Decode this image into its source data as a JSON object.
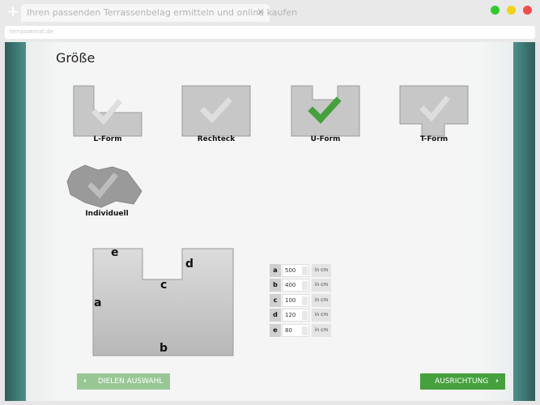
{
  "browser": {
    "tab_title": "Ihren passenden Terrassenbelag ermitteln und online kaufen",
    "url": "terrassenrat.de",
    "new_tab": "+",
    "close": "✕",
    "dot_colors": [
      "#31c930",
      "#f3d21a",
      "#ef4c4c"
    ]
  },
  "page": {
    "title": "Größe"
  },
  "shapes": [
    {
      "label": "L-Form",
      "selected": false
    },
    {
      "label": "Rechteck",
      "selected": false
    },
    {
      "label": "U-Form",
      "selected": true
    },
    {
      "label": "T-Form",
      "selected": false
    },
    {
      "label": "Individuell",
      "selected": false
    }
  ],
  "diagram": {
    "labels": {
      "a": "a",
      "b": "b",
      "c": "c",
      "d": "d",
      "e": "e"
    }
  },
  "dimensions": [
    {
      "key": "a",
      "value": "500",
      "unit": "in cm"
    },
    {
      "key": "b",
      "value": "400",
      "unit": "in cm"
    },
    {
      "key": "c",
      "value": "100",
      "unit": "in cm"
    },
    {
      "key": "d",
      "value": "120",
      "unit": "in cm"
    },
    {
      "key": "e",
      "value": "80",
      "unit": "in cm"
    }
  ],
  "buttons": {
    "back": "DIELEN AUSWAHL",
    "next": "AUSRICHTUNG",
    "back_arrow": "‹",
    "next_arrow": "›"
  },
  "colors": {
    "accent": "#45a03d",
    "accent_light": "#98c794",
    "shape_gray": "#c4c4c4"
  }
}
